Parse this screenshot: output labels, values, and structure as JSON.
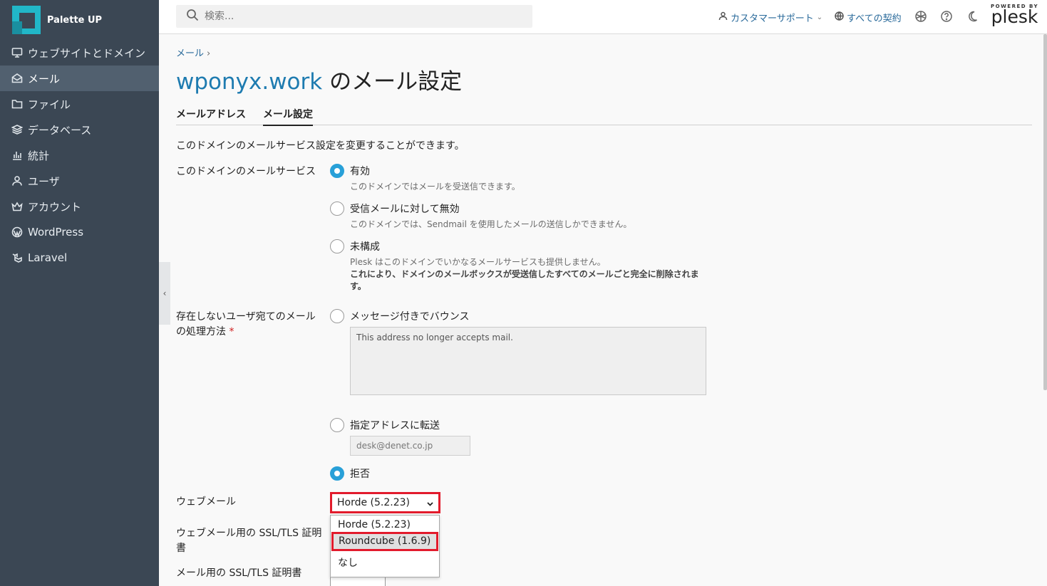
{
  "brand": {
    "name": "Palette UP"
  },
  "sidebar": {
    "items": [
      {
        "label": "ウェブサイトとドメイン",
        "icon": "monitor-icon",
        "active": false
      },
      {
        "label": "メール",
        "icon": "mail-icon",
        "active": true
      },
      {
        "label": "ファイル",
        "icon": "folder-icon",
        "active": false
      },
      {
        "label": "データベース",
        "icon": "database-icon",
        "active": false
      },
      {
        "label": "統計",
        "icon": "bar-chart-icon",
        "active": false
      },
      {
        "label": "ユーザ",
        "icon": "user-icon",
        "active": false
      },
      {
        "label": "アカウント",
        "icon": "crown-icon",
        "active": false
      },
      {
        "label": "WordPress",
        "icon": "wordpress-icon",
        "active": false
      },
      {
        "label": "Laravel",
        "icon": "laravel-icon",
        "active": false
      }
    ]
  },
  "header": {
    "search_placeholder": "検索...",
    "support_label": "カスタマーサポート",
    "contracts_label": "すべての契約",
    "plesk_powered": "POWERED BY",
    "plesk_name": "plesk"
  },
  "breadcrumb": {
    "item": "メール",
    "separator": "›"
  },
  "page": {
    "title_domain": "wponyx.work",
    "title_suffix": " のメール設定",
    "tabs": [
      {
        "label": "メールアドレス",
        "active": false
      },
      {
        "label": "メール設定",
        "active": true
      }
    ],
    "description": "このドメインのメールサービス設定を変更することができます。"
  },
  "mail_service": {
    "label": "このドメインのメールサービス",
    "options": [
      {
        "label": "有効",
        "hint": "このドメインではメールを受送信できます。",
        "selected": true
      },
      {
        "label": "受信メールに対して無効",
        "hint": "このドメインでは、Sendmail を使用したメールの送信しかできません。",
        "selected": false
      },
      {
        "label": "未構成",
        "hint": "Plesk はこのドメインでいかなるメールサービスも提供しません。",
        "warning_line1": "これにより、ドメインのメールボックスが受送信したすべてのメールごと完全に削除されま",
        "warning_line2": "す。",
        "selected": false
      }
    ]
  },
  "nonexistent_user": {
    "label_line1": "存在しないユーザ宛てのメール",
    "label_line2": "の処理方法",
    "required_mark": "*",
    "bounce_label": "メッセージ付きでバウンス",
    "bounce_message": "This address no longer accepts mail.",
    "forward_label": "指定アドレスに転送",
    "forward_address": "desk@denet.co.jp",
    "reject_label": "拒否",
    "selected": "reject"
  },
  "webmail": {
    "label": "ウェブメール",
    "selected": "Horde (5.2.23)",
    "options": [
      "Horde (5.2.23)",
      "Roundcube (1.6.9)",
      "なし"
    ],
    "highlighted": "Roundcube (1.6.9)"
  },
  "webmail_ssl": {
    "label_line1": "ウェブメール用の SSL/TLS 証明",
    "label_line2": "書"
  },
  "mail_ssl": {
    "label": "メール用の SSL/TLS 証明書"
  },
  "colors": {
    "accent": "#28a0d8",
    "link": "#1e7bb0",
    "sidebar": "#3b4754",
    "highlight": "#e21b2c"
  }
}
